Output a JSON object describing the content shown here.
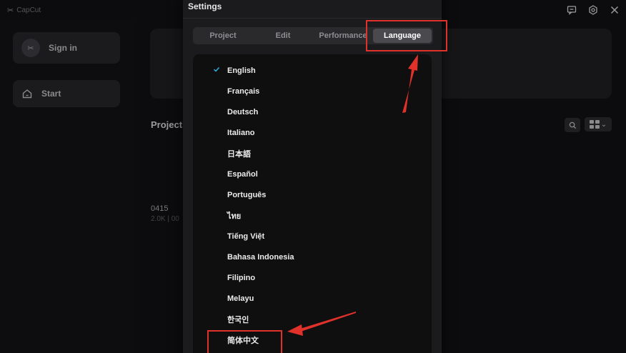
{
  "app": {
    "logo_text": "CapCut"
  },
  "sidebar": {
    "sign_in_label": "Sign in",
    "start_label": "Start"
  },
  "main": {
    "projects_title": "Projects",
    "project": {
      "name": "0415",
      "meta": "2.0K | 00"
    }
  },
  "settings": {
    "title": "Settings",
    "tabs": [
      {
        "label": "Project"
      },
      {
        "label": "Edit"
      },
      {
        "label": "Performance"
      },
      {
        "label": "Language",
        "active": true
      }
    ],
    "selected_language": "English",
    "languages": [
      {
        "label": "English",
        "selected": true
      },
      {
        "label": "Français"
      },
      {
        "label": "Deutsch"
      },
      {
        "label": "Italiano"
      },
      {
        "label": "日本語"
      },
      {
        "label": "Español"
      },
      {
        "label": "Português"
      },
      {
        "label": "ไทย"
      },
      {
        "label": "Tiếng Việt"
      },
      {
        "label": "Bahasa Indonesia"
      },
      {
        "label": "Filipino"
      },
      {
        "label": "Melayu"
      },
      {
        "label": "한국인"
      },
      {
        "label": "简体中文"
      }
    ]
  },
  "colors": {
    "accent_check": "#2fb5e8",
    "annotation_red": "#e0312b",
    "active_tab": "#4a4a4e"
  },
  "icons": {
    "feedback": "feedback-icon",
    "settings": "gear-icon",
    "close": "close-icon",
    "check": "check-icon",
    "home": "home-icon",
    "search": "search-icon",
    "view_toggle": "grid-view-icon"
  }
}
